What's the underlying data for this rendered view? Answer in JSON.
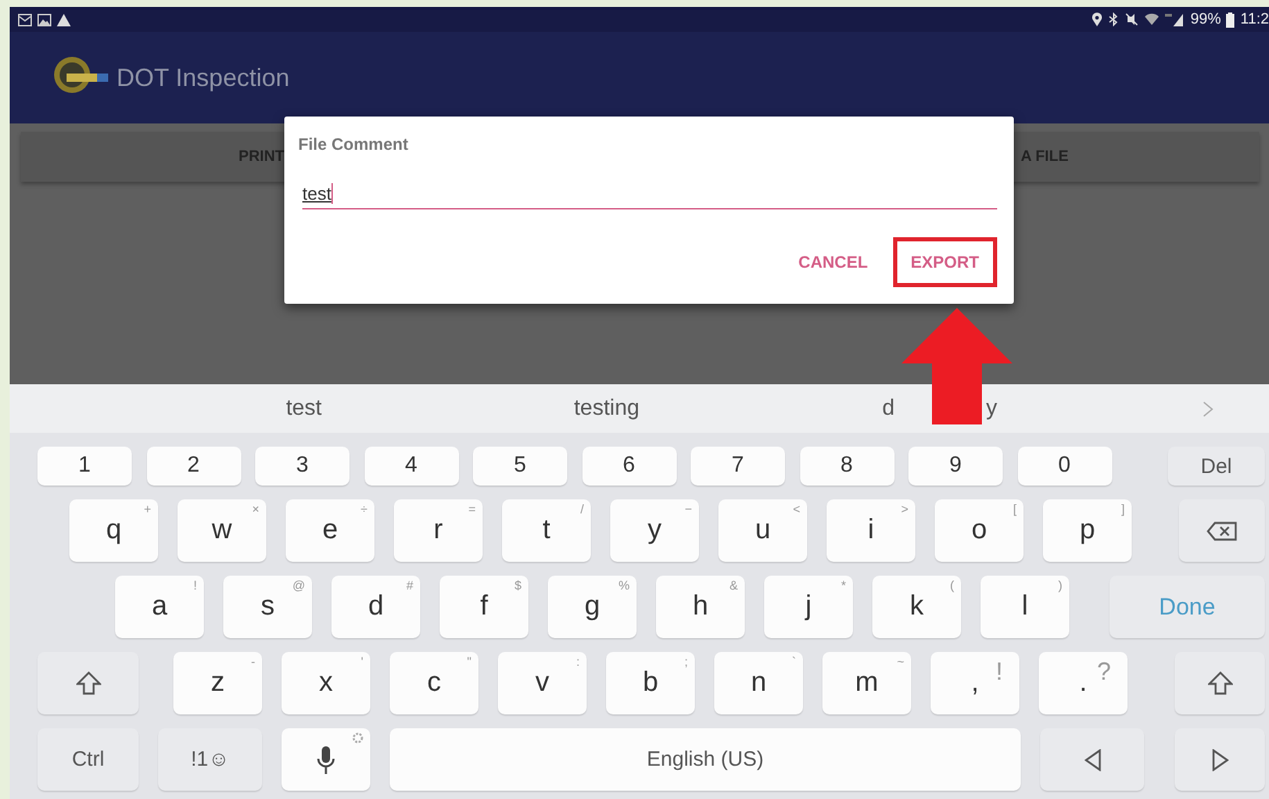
{
  "status_bar": {
    "battery": "99%",
    "time": "11:2"
  },
  "app_bar": {
    "title": "DOT Inspection"
  },
  "actions": [
    {
      "label": "PRINT"
    },
    {
      "label": "A FILE"
    }
  ],
  "dialog": {
    "title": "File Comment",
    "value": "test",
    "buttons": [
      {
        "label": "CANCEL",
        "highlighted": false
      },
      {
        "label": "EXPORT",
        "highlighted": true
      }
    ]
  },
  "suggestions": [
    {
      "parts": [
        "test"
      ]
    },
    {
      "parts": [
        "testing"
      ]
    },
    {
      "parts": [
        "d",
        "y"
      ]
    }
  ],
  "keyboard": {
    "rows": [
      {
        "keys": [
          {
            "kind": "num",
            "label": "1"
          },
          {
            "kind": "num",
            "label": "2"
          },
          {
            "kind": "num",
            "label": "3"
          },
          {
            "kind": "num",
            "label": "4"
          },
          {
            "kind": "num",
            "label": "5"
          },
          {
            "kind": "num",
            "label": "6"
          },
          {
            "kind": "num",
            "label": "7"
          },
          {
            "kind": "num",
            "label": "8"
          },
          {
            "kind": "num",
            "label": "9"
          },
          {
            "kind": "num",
            "label": "0"
          },
          {
            "kind": "func",
            "label": "Del"
          }
        ]
      },
      {
        "keys": [
          {
            "kind": "letter",
            "label": "q",
            "hint": "+"
          },
          {
            "kind": "letter",
            "label": "w",
            "hint": "×"
          },
          {
            "kind": "letter",
            "label": "e",
            "hint": "÷"
          },
          {
            "kind": "letter",
            "label": "r",
            "hint": "="
          },
          {
            "kind": "letter",
            "label": "t",
            "hint": "/"
          },
          {
            "kind": "letter",
            "label": "y",
            "hint": "−"
          },
          {
            "kind": "letter",
            "label": "u",
            "hint": "<"
          },
          {
            "kind": "letter",
            "label": "i",
            "hint": ">"
          },
          {
            "kind": "letter",
            "label": "o",
            "hint": "["
          },
          {
            "kind": "letter",
            "label": "p",
            "hint": "]"
          },
          {
            "kind": "backspace"
          }
        ]
      },
      {
        "keys": [
          {
            "kind": "letter",
            "label": "a",
            "hint": "!"
          },
          {
            "kind": "letter",
            "label": "s",
            "hint": "@"
          },
          {
            "kind": "letter",
            "label": "d",
            "hint": "#"
          },
          {
            "kind": "letter",
            "label": "f",
            "hint": "$"
          },
          {
            "kind": "letter",
            "label": "g",
            "hint": "%"
          },
          {
            "kind": "letter",
            "label": "h",
            "hint": "&"
          },
          {
            "kind": "letter",
            "label": "j",
            "hint": "*"
          },
          {
            "kind": "letter",
            "label": "k",
            "hint": "("
          },
          {
            "kind": "letter",
            "label": "l",
            "hint": ")"
          },
          {
            "kind": "done",
            "label": "Done"
          }
        ]
      },
      {
        "keys": [
          {
            "kind": "shift"
          },
          {
            "kind": "letter",
            "label": "z",
            "hint": "-"
          },
          {
            "kind": "letter",
            "label": "x",
            "hint": "'"
          },
          {
            "kind": "letter",
            "label": "c",
            "hint": "\""
          },
          {
            "kind": "letter",
            "label": "v",
            "hint": ":"
          },
          {
            "kind": "letter",
            "label": "b",
            "hint": ";"
          },
          {
            "kind": "letter",
            "label": "n",
            "hint": "`"
          },
          {
            "kind": "letter",
            "label": "m",
            "hint": "~"
          },
          {
            "kind": "punct",
            "label": ",",
            "hint": "!"
          },
          {
            "kind": "punct",
            "label": ".",
            "hint": "?"
          },
          {
            "kind": "shift"
          }
        ]
      },
      {
        "keys": [
          {
            "kind": "func",
            "label": "Ctrl"
          },
          {
            "kind": "func",
            "label": "!1☺"
          },
          {
            "kind": "mic"
          },
          {
            "kind": "space",
            "label": "English (US)"
          },
          {
            "kind": "left"
          },
          {
            "kind": "right"
          }
        ]
      }
    ]
  }
}
